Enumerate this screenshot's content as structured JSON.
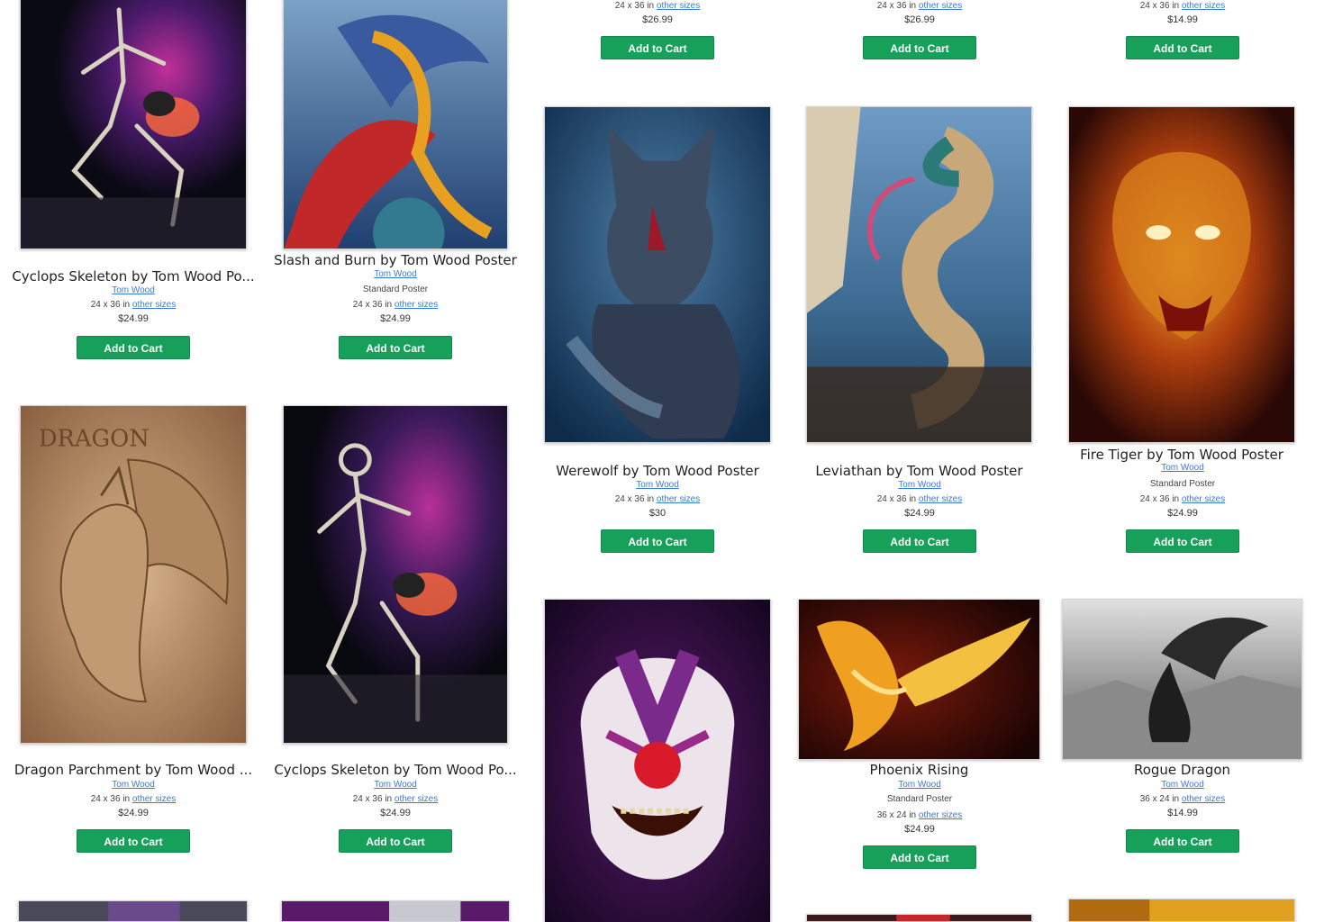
{
  "cart_label": "Add to Cart",
  "products": {
    "top_col3": {
      "size": "24 x 36 in",
      "sizes_link": "other sizes",
      "price": "$26.99"
    },
    "top_col4": {
      "size": "24 x 36 in",
      "sizes_link": "other sizes",
      "price": "$26.99"
    },
    "top_col5": {
      "size": "24 x 36 in",
      "sizes_link": "other sizes",
      "price": "$14.99"
    },
    "cyclops1": {
      "title": "Cyclops Skeleton by Tom Wood Po...",
      "brand": "Tom Wood",
      "size": "24 x 36 in",
      "sizes_link": "other sizes",
      "price": "$24.99"
    },
    "slash": {
      "title": "Slash and Burn by Tom Wood Poster",
      "brand": "Tom Wood",
      "type": "Standard Poster",
      "size": "24 x 36 in",
      "sizes_link": "other sizes",
      "price": "$24.99"
    },
    "werewolf": {
      "title": "Werewolf by Tom Wood Poster",
      "brand": "Tom Wood",
      "size": "24 x 36 in",
      "sizes_link": "other sizes",
      "price": "$30"
    },
    "leviathan": {
      "title": "Leviathan by Tom Wood Poster",
      "brand": "Tom Wood",
      "size": "24 x 36 in",
      "sizes_link": "other sizes",
      "price": "$24.99"
    },
    "fire_tiger": {
      "title": "Fire Tiger by Tom Wood Poster",
      "brand": "Tom Wood",
      "type": "Standard Poster",
      "size": "24 x 36 in",
      "sizes_link": "other sizes",
      "price": "$24.99"
    },
    "dragon_parchment": {
      "title": "Dragon Parchment by Tom Wood ...",
      "brand": "Tom Wood",
      "size": "24 x 36 in",
      "sizes_link": "other sizes",
      "price": "$24.99"
    },
    "cyclops2": {
      "title": "Cyclops Skeleton by Tom Wood Po...",
      "brand": "Tom Wood",
      "size": "24 x 36 in",
      "sizes_link": "other sizes",
      "price": "$24.99"
    },
    "phoenix": {
      "title": "Phoenix Rising",
      "brand": "Tom Wood",
      "type": "Standard Poster",
      "size": "36 x 24 in",
      "sizes_link": "other sizes",
      "price": "$24.99"
    },
    "rogue_dragon": {
      "title": "Rogue Dragon",
      "brand": "Tom Wood",
      "size": "36 x 24 in",
      "sizes_link": "other sizes",
      "price": "$14.99"
    }
  },
  "art_text": {
    "dragon_parchment": "DRAGON"
  }
}
